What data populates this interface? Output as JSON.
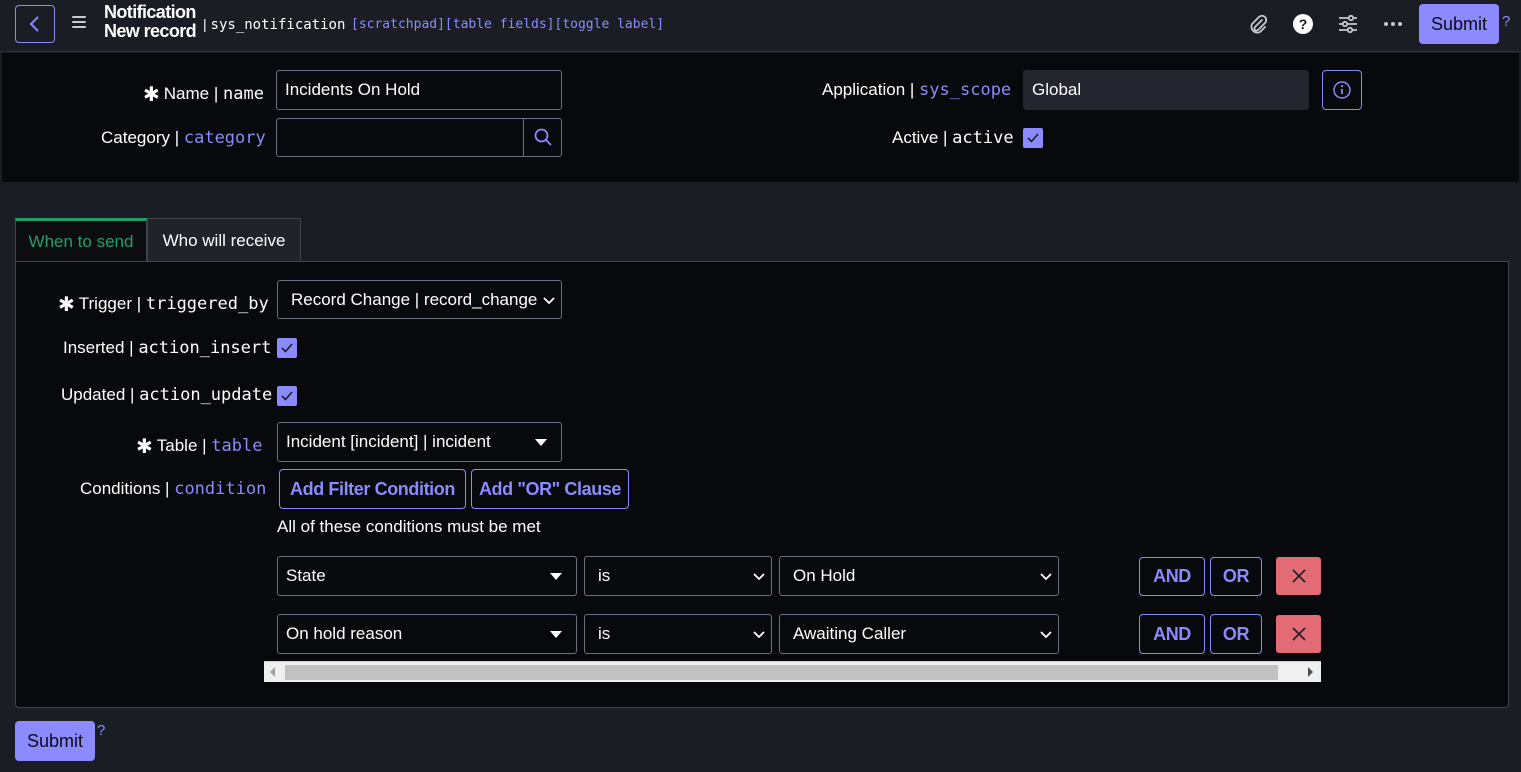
{
  "header": {
    "title_line1": "Notification",
    "title_line2": "New record",
    "table_sep": "|",
    "table_name": "sys_notification",
    "links": "[scratchpad][table fields][toggle label]",
    "submit_label": "Submit",
    "help": "?"
  },
  "form": {
    "name": {
      "required": "✱",
      "label": "Name |",
      "field": "name",
      "value": "Incidents On Hold"
    },
    "category": {
      "label": "Category |",
      "field": "category",
      "value": ""
    },
    "application": {
      "label": "Application |",
      "field": "sys_scope",
      "value": "Global"
    },
    "active": {
      "label": "Active |",
      "field": "active",
      "checked": true
    }
  },
  "tabs": [
    {
      "label": "When to send",
      "active": true
    },
    {
      "label": "Who will receive",
      "active": false
    }
  ],
  "when_to_send": {
    "trigger": {
      "required": "✱",
      "label": "Trigger |",
      "field": "triggered_by",
      "value": "Record Change | record_change"
    },
    "inserted": {
      "label": "Inserted |",
      "field": "action_insert",
      "checked": true
    },
    "updated": {
      "label": "Updated |",
      "field": "action_update",
      "checked": true
    },
    "table": {
      "required": "✱",
      "label": "Table |",
      "field": "table",
      "value": "Incident [incident] | incident"
    },
    "conditions": {
      "label": "Conditions |",
      "field": "condition",
      "add_filter_label": "Add Filter Condition",
      "add_or_label": "Add \"OR\" Clause",
      "summary": "All of these conditions must be met",
      "rows": [
        {
          "field": "State",
          "operator": "is",
          "value": "On Hold",
          "and_label": "AND",
          "or_label": "OR"
        },
        {
          "field": "On hold reason",
          "operator": "is",
          "value": "Awaiting Caller",
          "and_label": "AND",
          "or_label": "OR"
        }
      ]
    }
  },
  "footer": {
    "submit_label": "Submit",
    "help": "?"
  },
  "colors": {
    "accent": "#8b8bff",
    "tab_active": "#1fa16b",
    "delete": "#e26b75"
  },
  "icons": [
    "back-icon",
    "menu-icon",
    "attachment-icon",
    "help-icon",
    "settings-icon",
    "more-icon",
    "search-icon",
    "info-icon",
    "check-icon",
    "chevron-down-icon",
    "close-icon"
  ]
}
